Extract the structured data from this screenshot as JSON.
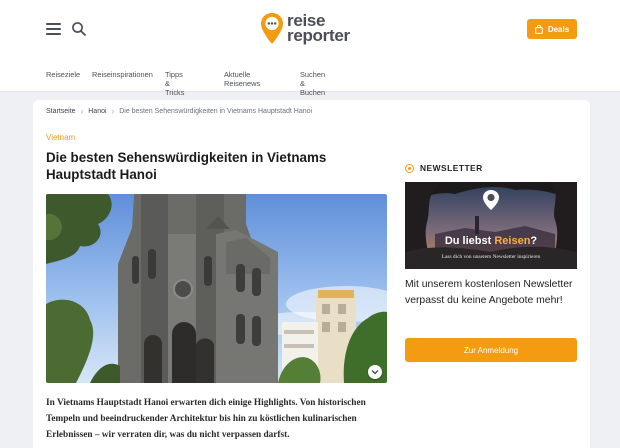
{
  "header": {
    "logo_line1": "reise",
    "logo_line2": "reporter",
    "deals_label": "Deals"
  },
  "nav": {
    "items": [
      "Reiseziele",
      "Reiseinspirationen",
      "Tipps & Tricks",
      "Aktuelle Reisenews",
      "Suchen & Buchen"
    ]
  },
  "breadcrumb": {
    "home": "Startseite",
    "level1": "Hanoi",
    "current": "Die besten Sehenswürdigkeiten in Vietnams Hauptstadt Hanoi"
  },
  "article": {
    "category": "Vietnam",
    "title": "Die besten Sehenswürdigkeiten in Vietnams Hauptstadt Hanoi",
    "lead": "In Vietnams Hauptstadt Hanoi erwarten dich einige Highlights. Von historischen Tempeln und beeindruckender Architektur bis hin zu köstlichen kulinarischen Erlebnissen – wir verraten dir, was du nicht verpassen darfst."
  },
  "newsletter": {
    "heading": "NEWSLETTER",
    "banner_headline_part1": "Du liebst ",
    "banner_headline_part2": "Reisen",
    "banner_headline_part3": "?",
    "banner_sub": "Lass dich von unserem Newsletter inspirieren",
    "text": "Mit unserem kostenlosen Newsletter verpasst du keine Angebote mehr!",
    "button_label": "Zur Anmeldung"
  },
  "colors": {
    "accent": "#f39c12",
    "text_dark": "#1f1f1f",
    "page_bg": "#eef0f4"
  },
  "icons": {
    "menu": "hamburger-menu-icon",
    "search": "search-icon",
    "deals": "shopping-bag-icon",
    "logo": "location-pin-logo-icon",
    "expand": "chevron-down-icon"
  }
}
